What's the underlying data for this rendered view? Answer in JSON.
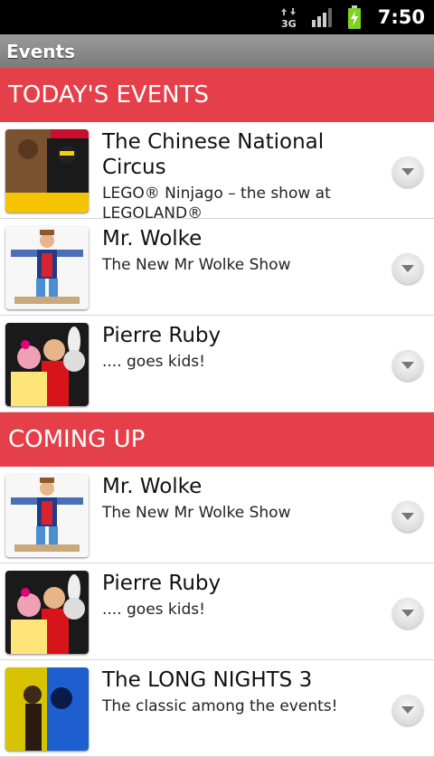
{
  "status": {
    "network": "3G",
    "time": "7:50"
  },
  "app": {
    "title": "Events"
  },
  "sections": [
    {
      "label": "TODAY'S EVENTS"
    },
    {
      "label": "COMING UP"
    }
  ],
  "today": [
    {
      "title": "The Chinese National Circus",
      "subtitle": "LEGO® Ninjago – the show at LEGOLAND®"
    },
    {
      "title": "Mr. Wolke",
      "subtitle": "The New Mr Wolke Show"
    },
    {
      "title": "Pierre Ruby",
      "subtitle": ".... goes kids!"
    }
  ],
  "upcoming": [
    {
      "title": "Mr. Wolke",
      "subtitle": "The New Mr Wolke Show"
    },
    {
      "title": "Pierre Ruby",
      "subtitle": ".... goes kids!"
    },
    {
      "title": "The LONG NIGHTS 3",
      "subtitle": "The classic among the events!"
    }
  ],
  "colors": {
    "section_bg": "#e5404a",
    "titlebar_bg": "#8a8a8a",
    "battery": "#7ed321"
  }
}
